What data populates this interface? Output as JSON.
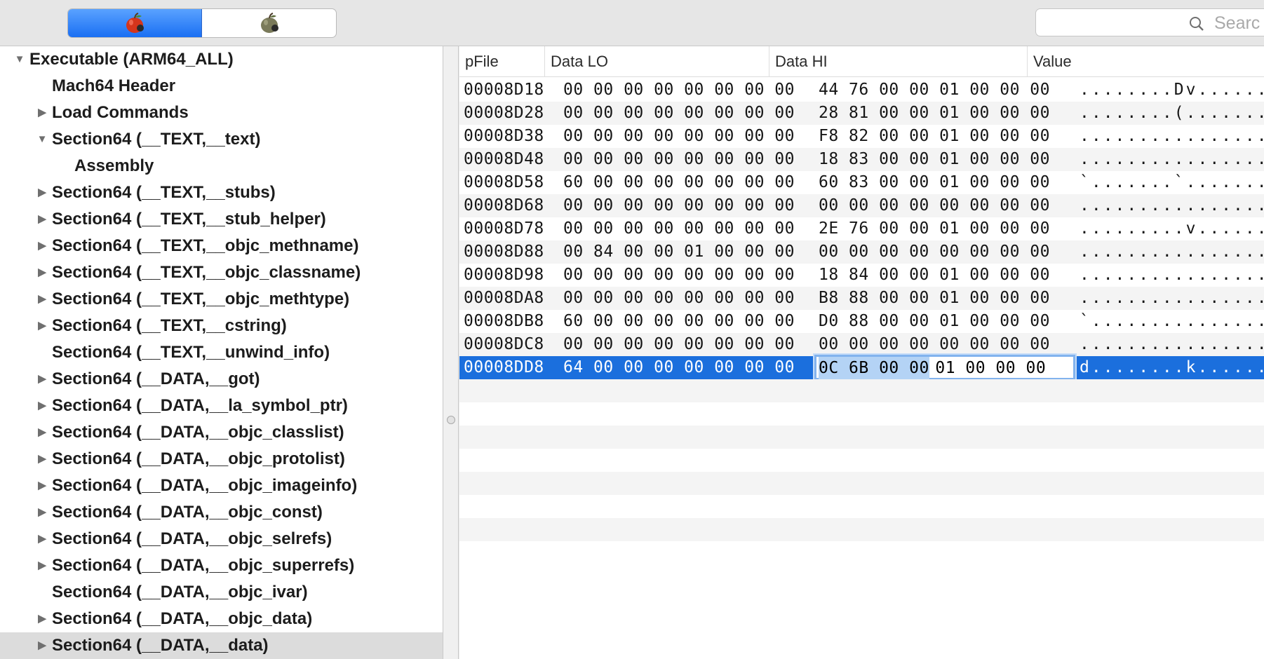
{
  "toolbar": {
    "segments": [
      "red-apple-icon",
      "gray-apple-icon"
    ],
    "search_placeholder": "Searc"
  },
  "tree": [
    {
      "label": "Executable  (ARM64_ALL)",
      "level": 0,
      "disclosure": "expanded"
    },
    {
      "label": "Mach64 Header",
      "level": 1,
      "disclosure": "none"
    },
    {
      "label": "Load Commands",
      "level": 1,
      "disclosure": "collapsed"
    },
    {
      "label": "Section64 (__TEXT,__text)",
      "level": 1,
      "disclosure": "expanded"
    },
    {
      "label": "Assembly",
      "level": 2,
      "disclosure": "none"
    },
    {
      "label": "Section64 (__TEXT,__stubs)",
      "level": 1,
      "disclosure": "collapsed"
    },
    {
      "label": "Section64 (__TEXT,__stub_helper)",
      "level": 1,
      "disclosure": "collapsed"
    },
    {
      "label": "Section64 (__TEXT,__objc_methname)",
      "level": 1,
      "disclosure": "collapsed"
    },
    {
      "label": "Section64 (__TEXT,__objc_classname)",
      "level": 1,
      "disclosure": "collapsed"
    },
    {
      "label": "Section64 (__TEXT,__objc_methtype)",
      "level": 1,
      "disclosure": "collapsed"
    },
    {
      "label": "Section64 (__TEXT,__cstring)",
      "level": 1,
      "disclosure": "collapsed"
    },
    {
      "label": "Section64 (__TEXT,__unwind_info)",
      "level": 1,
      "disclosure": "none"
    },
    {
      "label": "Section64 (__DATA,__got)",
      "level": 1,
      "disclosure": "collapsed"
    },
    {
      "label": "Section64 (__DATA,__la_symbol_ptr)",
      "level": 1,
      "disclosure": "collapsed"
    },
    {
      "label": "Section64 (__DATA,__objc_classlist)",
      "level": 1,
      "disclosure": "collapsed"
    },
    {
      "label": "Section64 (__DATA,__objc_protolist)",
      "level": 1,
      "disclosure": "collapsed"
    },
    {
      "label": "Section64 (__DATA,__objc_imageinfo)",
      "level": 1,
      "disclosure": "collapsed"
    },
    {
      "label": "Section64 (__DATA,__objc_const)",
      "level": 1,
      "disclosure": "collapsed"
    },
    {
      "label": "Section64 (__DATA,__objc_selrefs)",
      "level": 1,
      "disclosure": "collapsed"
    },
    {
      "label": "Section64 (__DATA,__objc_superrefs)",
      "level": 1,
      "disclosure": "collapsed"
    },
    {
      "label": "Section64 (__DATA,__objc_ivar)",
      "level": 1,
      "disclosure": "none"
    },
    {
      "label": "Section64 (__DATA,__objc_data)",
      "level": 1,
      "disclosure": "collapsed"
    },
    {
      "label": "Section64 (__DATA,__data)",
      "level": 1,
      "disclosure": "collapsed",
      "selected": true
    }
  ],
  "table": {
    "columns": [
      "pFile",
      "Data LO",
      "Data HI",
      "Value"
    ],
    "rows": [
      {
        "pfile": "00008D18",
        "lo": "00 00 00 00 00 00 00 00",
        "hi": "44 76 00 00 01 00 00 00",
        "value": "........Dv......"
      },
      {
        "pfile": "00008D28",
        "lo": "00 00 00 00 00 00 00 00",
        "hi": "28 81 00 00 01 00 00 00",
        "value": "........(......."
      },
      {
        "pfile": "00008D38",
        "lo": "00 00 00 00 00 00 00 00",
        "hi": "F8 82 00 00 01 00 00 00",
        "value": "................"
      },
      {
        "pfile": "00008D48",
        "lo": "00 00 00 00 00 00 00 00",
        "hi": "18 83 00 00 01 00 00 00",
        "value": "................"
      },
      {
        "pfile": "00008D58",
        "lo": "60 00 00 00 00 00 00 00",
        "hi": "60 83 00 00 01 00 00 00",
        "value": "`.......`......."
      },
      {
        "pfile": "00008D68",
        "lo": "00 00 00 00 00 00 00 00",
        "hi": "00 00 00 00 00 00 00 00",
        "value": "................"
      },
      {
        "pfile": "00008D78",
        "lo": "00 00 00 00 00 00 00 00",
        "hi": "2E 76 00 00 01 00 00 00",
        "value": ".........v......"
      },
      {
        "pfile": "00008D88",
        "lo": "00 84 00 00 01 00 00 00",
        "hi": "00 00 00 00 00 00 00 00",
        "value": "................"
      },
      {
        "pfile": "00008D98",
        "lo": "00 00 00 00 00 00 00 00",
        "hi": "18 84 00 00 01 00 00 00",
        "value": "................"
      },
      {
        "pfile": "00008DA8",
        "lo": "00 00 00 00 00 00 00 00",
        "hi": "B8 88 00 00 01 00 00 00",
        "value": "................"
      },
      {
        "pfile": "00008DB8",
        "lo": "60 00 00 00 00 00 00 00",
        "hi": "D0 88 00 00 01 00 00 00",
        "value": "`..............."
      },
      {
        "pfile": "00008DC8",
        "lo": "00 00 00 00 00 00 00 00",
        "hi": "00 00 00 00 00 00 00 00",
        "value": "................"
      },
      {
        "pfile": "00008DD8",
        "lo": "64 00 00 00 00 00 00 00",
        "hi_selected": "0C 6B 00 00",
        "hi_rest": " 01 00 00 00",
        "value": "d........k......",
        "selected": true
      }
    ]
  },
  "colors": {
    "selection": "#1b6fdd",
    "segment_active": "#1a6ff3"
  }
}
